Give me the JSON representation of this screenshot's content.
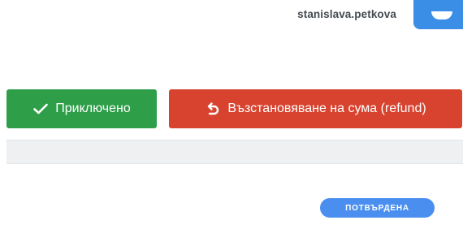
{
  "header": {
    "username": "stanislava.petkova"
  },
  "actions": {
    "done_label": "Приключено",
    "refund_label": "Възстановяване на сума (refund)"
  },
  "status": {
    "badge": "ПОТВЪРДЕНА"
  },
  "icons": {
    "done": "check-icon",
    "refund": "undo-arrow-icon",
    "avatar": "user-avatar"
  },
  "colors": {
    "done": "#2e9e48",
    "refund": "#d8432f",
    "badge": "#4a8ff0",
    "avatar": "#3a8ee6"
  }
}
